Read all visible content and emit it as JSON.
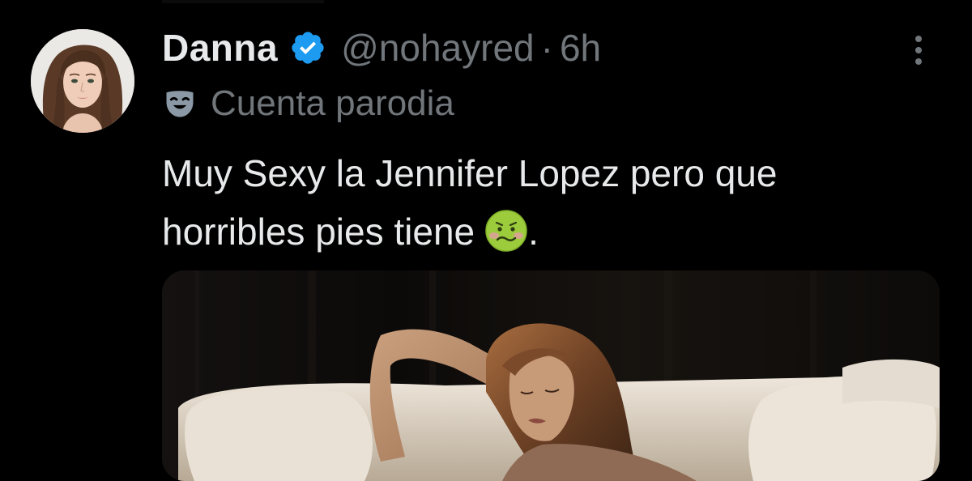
{
  "tweet": {
    "author": {
      "display_name": "Danna",
      "handle": "@nohayred",
      "verified": true,
      "avatar_icon": "profile-photo"
    },
    "separator": "·",
    "time_ago": "6h",
    "parody_label": "Cuenta parodia",
    "parody_icon": "theater-mask-icon",
    "text_lines": [
      "Muy Sexy la Jennifer Lopez pero que",
      "horribles pies tiene"
    ],
    "text_trailing": ".",
    "emoji": "nauseated-face-emoji",
    "media_type": "photo"
  },
  "colors": {
    "background": "#000000",
    "text_primary": "#e7e9ea",
    "text_secondary": "#71767b",
    "verified_badge": "#1d9bf0",
    "emoji_green": "#9ccc3c"
  }
}
